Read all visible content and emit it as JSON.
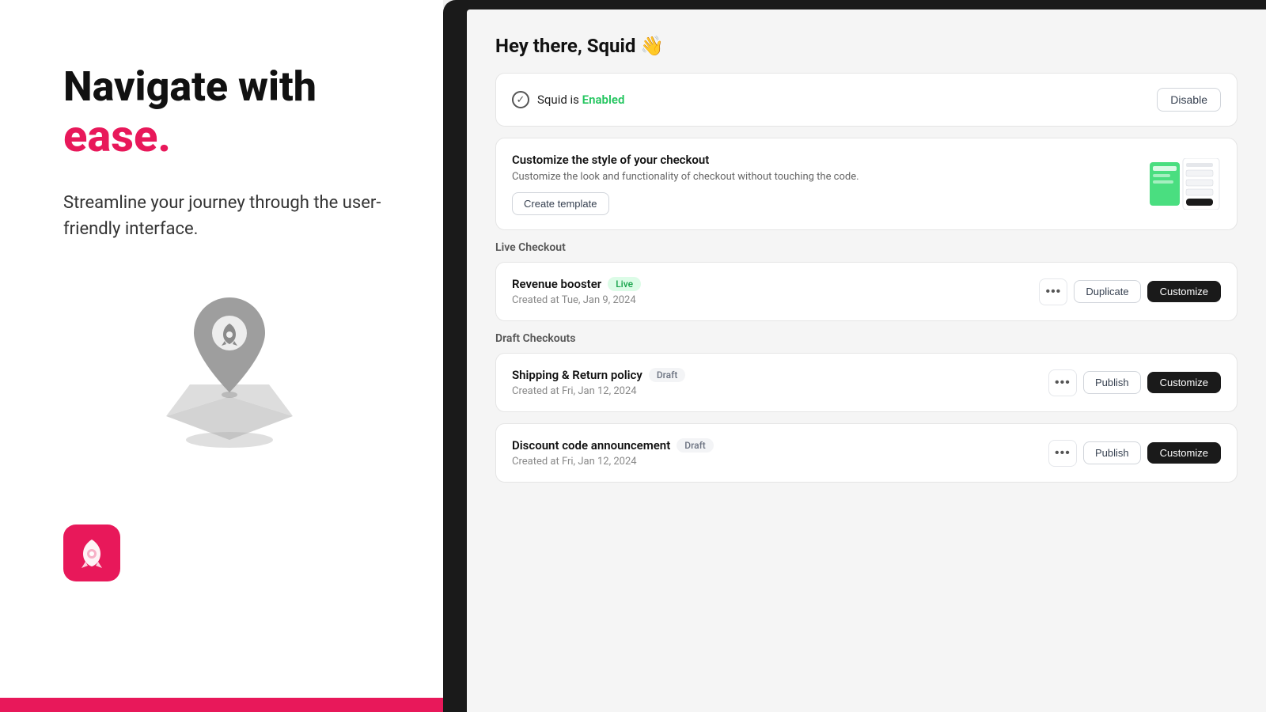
{
  "left": {
    "headline_line1": "Navigate with",
    "headline_accent": "ease.",
    "subtext": "Streamline your journey through the user-friendly interface.",
    "app_icon_alt": "squid-app-icon"
  },
  "right": {
    "greeting": "Hey there, Squid 👋",
    "status_card": {
      "squid_label": "Squid is",
      "status_value": "Enabled",
      "disable_btn": "Disable"
    },
    "customize_card": {
      "title": "Customize the style of your checkout",
      "description": "Customize the look and functionality of checkout without touching the code.",
      "create_btn": "Create template"
    },
    "live_section": {
      "label": "Live Checkout",
      "items": [
        {
          "name": "Revenue booster",
          "badge": "Live",
          "badge_type": "live",
          "created": "Created at Tue, Jan 9, 2024",
          "actions": [
            "more",
            "Duplicate",
            "Customize"
          ]
        }
      ]
    },
    "draft_section": {
      "label": "Draft Checkouts",
      "items": [
        {
          "name": "Shipping & Return policy",
          "badge": "Draft",
          "badge_type": "draft",
          "created": "Created at Fri, Jan 12, 2024",
          "actions": [
            "more",
            "Publish",
            "Customize"
          ]
        },
        {
          "name": "Discount code announcement",
          "badge": "Draft",
          "badge_type": "draft",
          "created": "Created at Fri, Jan 12, 2024",
          "actions": [
            "more",
            "Publish",
            "Customize"
          ]
        }
      ]
    }
  },
  "colors": {
    "accent": "#e8185a",
    "live_badge_bg": "#dcfce7",
    "live_badge_text": "#16a34a",
    "draft_badge_bg": "#f3f4f6",
    "draft_badge_text": "#6b7280"
  }
}
